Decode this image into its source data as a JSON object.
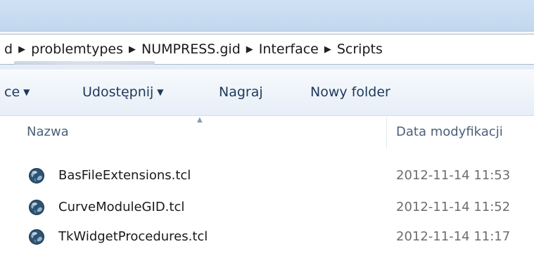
{
  "breadcrumb": [
    "d",
    "problemtypes",
    "NUMPRESS.gid",
    "Interface",
    "Scripts"
  ],
  "toolbar": {
    "organize_label": "ce",
    "share_label": "Udostępnij",
    "burn_label": "Nagraj",
    "new_folder_label": "Nowy folder"
  },
  "columns": {
    "name": "Nazwa",
    "date_modified": "Data modyfikacji"
  },
  "files": [
    {
      "name": "BasFileExtensions.tcl",
      "date": "2012-11-14 11:53",
      "icon": "tcl-script-icon"
    },
    {
      "name": "CurveModuleGID.tcl",
      "date": "2012-11-14 11:52",
      "icon": "tcl-script-icon"
    },
    {
      "name": "TkWidgetProcedures.tcl",
      "date": "2012-11-14 11:17",
      "icon": "tcl-script-icon"
    }
  ],
  "colors": {
    "toolbar_text": "#1e395b",
    "header_text": "#4c607a",
    "date_text": "#6d6d6d"
  }
}
